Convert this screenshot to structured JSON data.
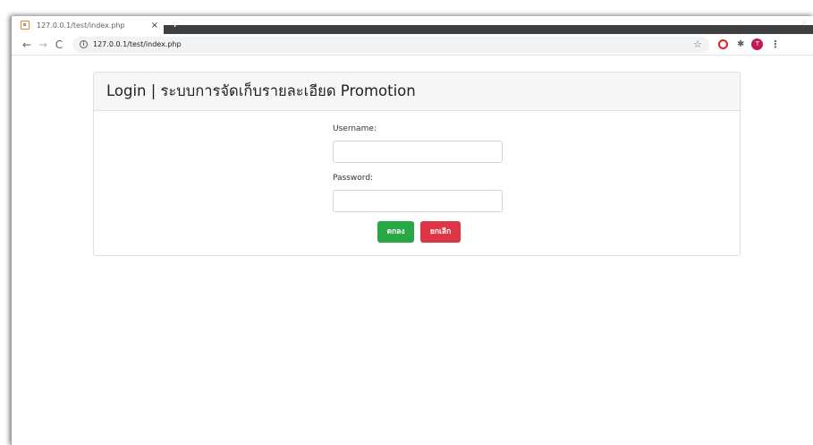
{
  "browser": {
    "tab": {
      "title": "127.0.0.1/test/index.php",
      "close_label": "×"
    },
    "new_tab_label": "+",
    "window_controls": {
      "minimize_label": "–",
      "close_label": "×"
    },
    "toolbar": {
      "back_label": "←",
      "forward_label": "→",
      "reload_label": "C",
      "info_label": "i",
      "url": "127.0.0.1/test/index.php",
      "bookmark_label": "☆",
      "extension_label": "✱",
      "profile_initial": "T",
      "menu_label": "⋮"
    },
    "colors": {
      "tab_strip_dark": "#3c4043",
      "opera_red": "#e0202e",
      "profile_pink": "#c2185b",
      "favicon_orange": "#e8842f"
    }
  },
  "page": {
    "card_title": "Login | ระบบการจัดเก็บรายละเอียด Promotion",
    "form": {
      "username_label": "Username:",
      "username_value": "",
      "password_label": "Password:",
      "password_value": "",
      "submit_label": "ตกลง",
      "cancel_label": "ยกเลิก"
    },
    "colors": {
      "submit": "#28a745",
      "cancel": "#dc3545"
    }
  }
}
